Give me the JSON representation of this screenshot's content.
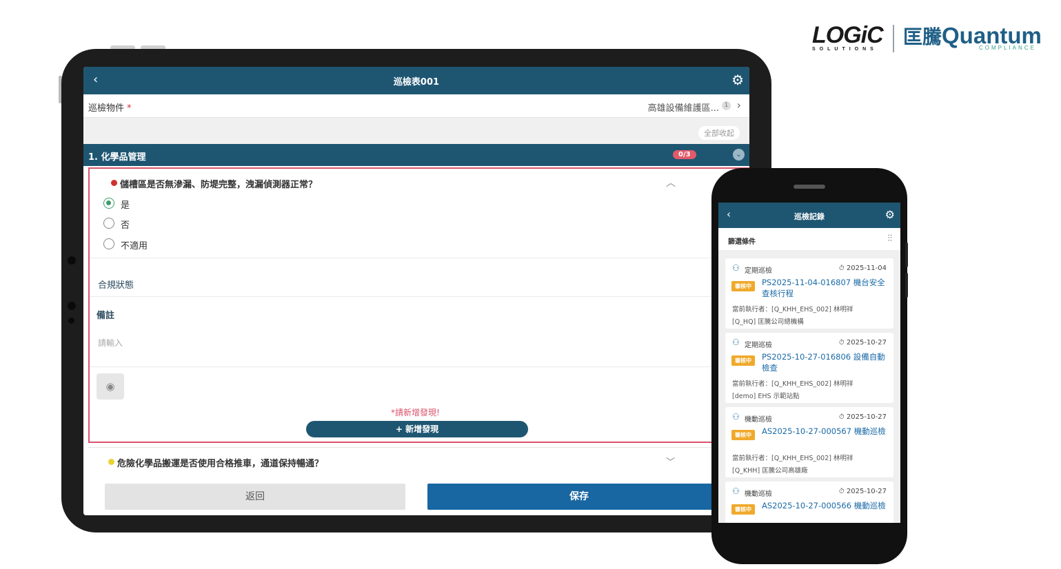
{
  "logos": {
    "logic_word": "LOGiC",
    "logic_sub": "SOLUTIONS",
    "quantum_cn": "匡騰",
    "quantum_en": "Quantum",
    "quantum_sub": "COMPLIANCE"
  },
  "tablet": {
    "title": "巡檢表001",
    "inspection_object": {
      "label": "巡檢物件",
      "required_mark": "*",
      "value": "高雄設備維護區...",
      "count": "1"
    },
    "collapse_all": "全部收起",
    "section": {
      "title": "1. 化學品管理",
      "progress": "0/3"
    },
    "question1": {
      "text": "儲槽區是否無滲漏、防堤完整，洩漏偵測器正常？",
      "options": [
        {
          "label": "是",
          "selected": true
        },
        {
          "label": "否",
          "selected": false
        },
        {
          "label": "不適用",
          "selected": false
        }
      ],
      "compliance_label": "合規狀態",
      "note_label": "備註",
      "note_placeholder": "請輸入",
      "warning": "*請新增發現!",
      "add_finding": "+ 新增發現"
    },
    "question2": {
      "text": "危險化學品搬運是否使用合格推車，通道保持暢通？"
    },
    "back_button": "返回",
    "save_button": "保存"
  },
  "phone": {
    "title": "巡檢記錄",
    "filter_label": "篩選條件",
    "records": [
      {
        "kind": "定期巡檢",
        "date": "2025-11-04",
        "status": "審核中",
        "code": "PS2025-11-04-016807 機台安全查核行程",
        "executor": "當前執行者：[Q_KHH_EHS_002] 林明祥",
        "org": "[Q_HQ] 匡騰公司總機構"
      },
      {
        "kind": "定期巡檢",
        "date": "2025-10-27",
        "status": "審核中",
        "code": "PS2025-10-27-016806 設備自動檢查",
        "executor": "當前執行者：[Q_KHH_EHS_002] 林明祥",
        "org": "[demo] EHS 示範站點"
      },
      {
        "kind": "機動巡檢",
        "date": "2025-10-27",
        "status": "審核中",
        "code": "AS2025-10-27-000567 機動巡檢",
        "executor": "當前執行者：[Q_KHH_EHS_002] 林明祥",
        "org": "[Q_KHH] 匡騰公司高雄廠"
      },
      {
        "kind": "機動巡檢",
        "date": "2025-10-27",
        "status": "審核中",
        "code": "AS2025-10-27-000566 機動巡檢",
        "executor": "",
        "org": ""
      }
    ]
  },
  "colors": {
    "header": "#1e5672",
    "accent_red": "#d9536b",
    "save_blue": "#1866a2",
    "badge_orange": "#f0a92b"
  }
}
